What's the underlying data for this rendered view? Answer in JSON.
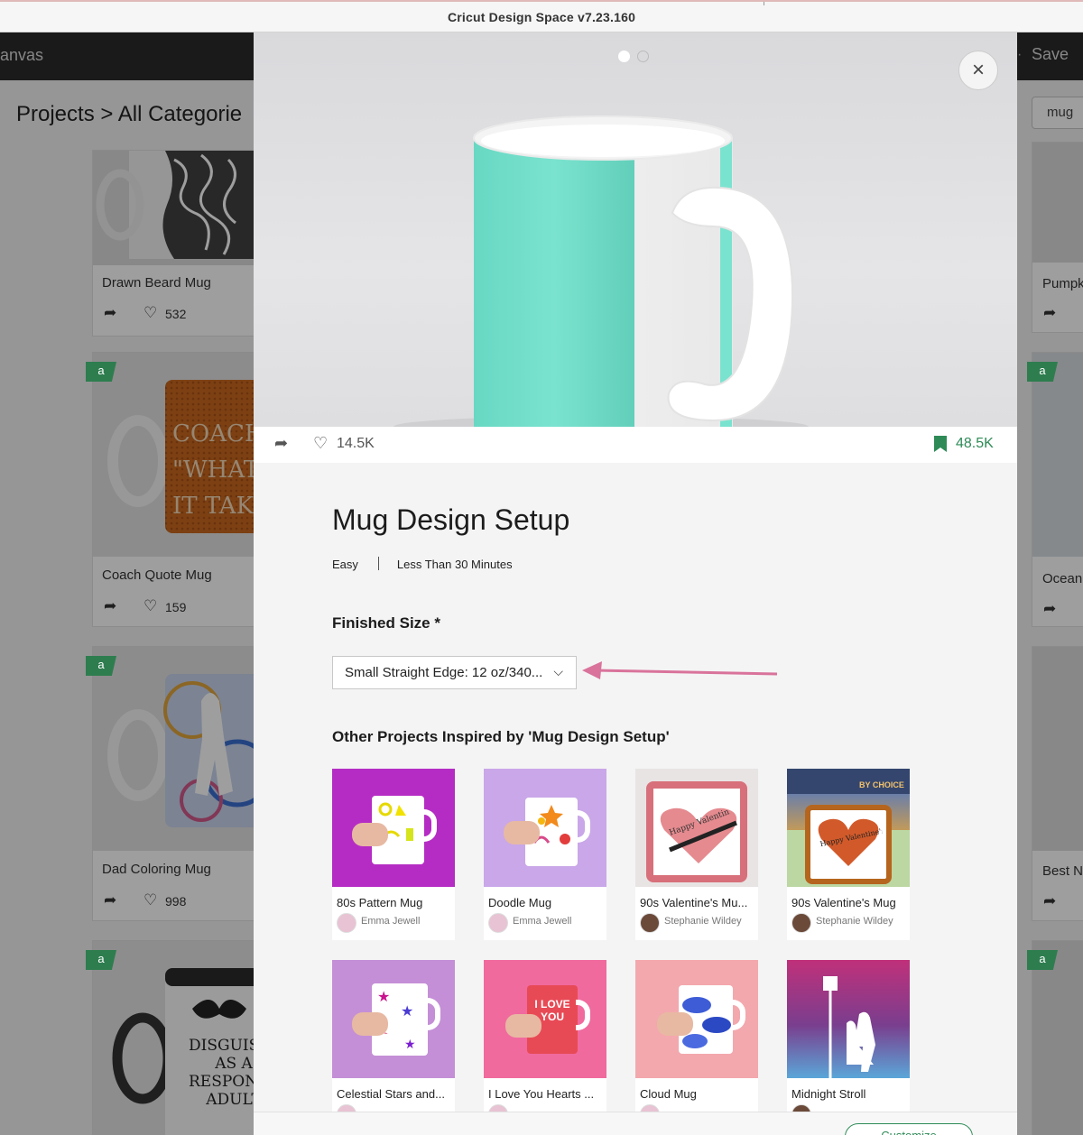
{
  "window": {
    "title": "Cricut Design Space  v7.23.160"
  },
  "appbar": {
    "left_label": "anvas",
    "save_label": "Save"
  },
  "page": {
    "breadcrumb": "Projects > All Categorie",
    "search_value": "mug",
    "cards": [
      {
        "name": "Drawn Beard Mug",
        "likes": "532"
      },
      {
        "name": "Coach Quote Mug",
        "likes": "159"
      },
      {
        "name": "Dad Coloring Mug",
        "likes": "998"
      }
    ],
    "right_cards": [
      {
        "name": "Pumpk"
      },
      {
        "name": "Ocean"
      },
      {
        "name": "Best N"
      }
    ],
    "badge_letter": "a",
    "mug_text_1": [
      "COACH CA",
      "\"WHATEV",
      "IT TAKE"
    ],
    "mug_text_2": [
      "DISGUISED",
      "AS A",
      "RESPONSIBL",
      "ADULT"
    ]
  },
  "modal": {
    "close_icon": "×",
    "likes": "14.5K",
    "saves": "48.5K",
    "title": "Mug Design Setup",
    "difficulty": "Easy",
    "duration": "Less Than 30 Minutes",
    "finished_size_label": "Finished Size *",
    "finished_size_value": "Small Straight Edge: 12 oz/340...",
    "other_heading": "Other Projects Inspired by 'Mug Design Setup'",
    "projects": [
      {
        "name": "80s Pattern Mug",
        "author": "Emma Jewell"
      },
      {
        "name": "Doodle Mug",
        "author": "Emma Jewell"
      },
      {
        "name": "90s Valentine's Mu...",
        "author": "Stephanie Wildey"
      },
      {
        "name": "90s Valentine's Mug",
        "author": "Stephanie Wildey"
      },
      {
        "name": "Celestial Stars and...",
        "author": ""
      },
      {
        "name": "I Love You Hearts ...",
        "author": ""
      },
      {
        "name": "Cloud Mug",
        "author": ""
      },
      {
        "name": "Midnight Stroll",
        "author": ""
      }
    ],
    "tile_texts": {
      "valentine": "Happy Valentine's Day",
      "choice": "BY CHOICE",
      "love_you": "I LOVE YOU"
    },
    "customize_label": "Customize"
  },
  "colors": {
    "accent_green": "#2e8b57",
    "arrow_pink": "#d9739b",
    "mug_teal": "#6fdcc7"
  }
}
